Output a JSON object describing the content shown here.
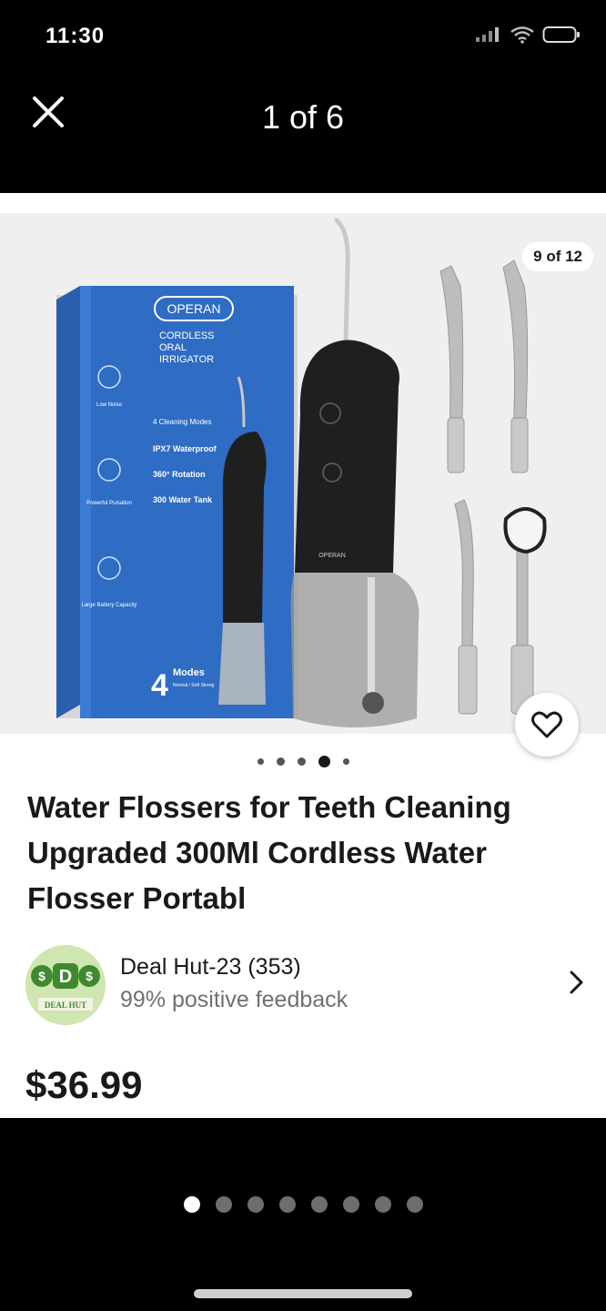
{
  "status_bar": {
    "time": "11:30",
    "icons": [
      "signal-icon",
      "wifi-icon",
      "battery-icon"
    ]
  },
  "viewer": {
    "close_icon": "close-icon",
    "counter": "1 of 6",
    "pager": {
      "total": 8,
      "active_index": 0
    }
  },
  "listing": {
    "image_counter": "9 of 12",
    "image_dots": {
      "count": 5,
      "active_index": 3
    },
    "product_box_text": {
      "brand": "OPERAN",
      "line1": "CORDLESS",
      "line2": "ORAL",
      "line3": "IRRIGATOR",
      "feature1": "4 Cleaning Modes",
      "feature2": "IPX7 Waterproof",
      "feature3": "360° Rotation",
      "feature4": "300 Water Tank",
      "side1": "Low Noise",
      "side2": "Powerful Pulsation",
      "side3": "Large Battery Capacity",
      "modes_number": "4",
      "modes_label": "Modes",
      "modes_sub": "Normal / Soft Strong",
      "device_brand": "OPERAN"
    },
    "title": "Water Flossers for Teeth Cleaning Upgraded 300Ml Cordless Water Flosser Portabl",
    "seller": {
      "name": "Deal Hut-23 (353)",
      "feedback": "99% positive feedback",
      "logo_text": "DEAL HUT"
    },
    "price": "$36.99",
    "wishlist_icon": "heart-icon"
  },
  "colors": {
    "box_blue": "#2f6cc4",
    "device_black": "#1f1f1f",
    "logo_green": "#3f8a2e"
  }
}
